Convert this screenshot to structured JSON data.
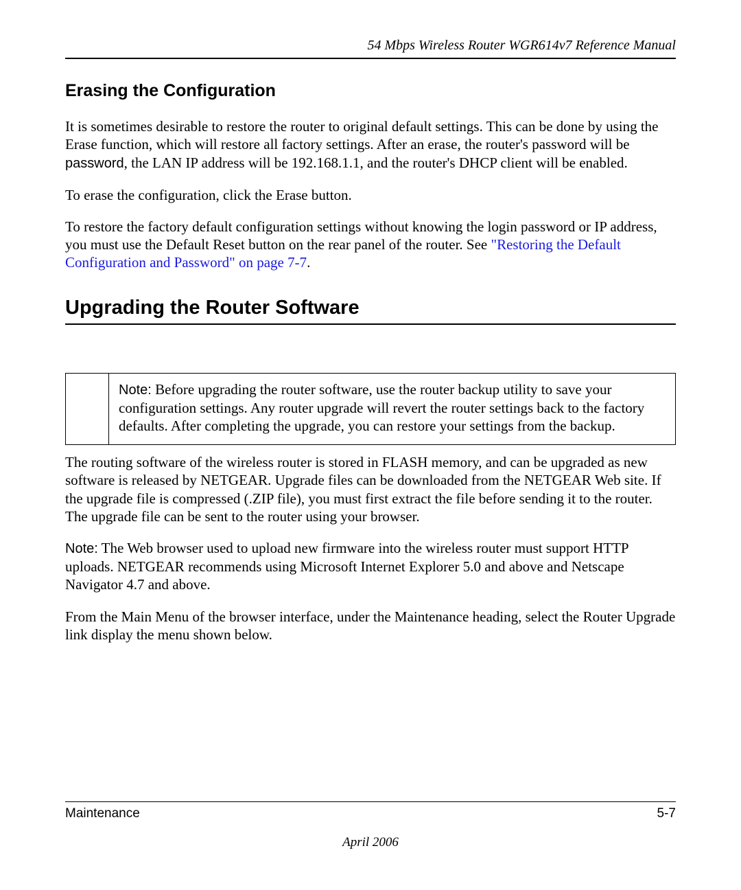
{
  "header": {
    "running_title": "54 Mbps Wireless Router WGR614v7 Reference Manual"
  },
  "section1": {
    "heading": "Erasing the Configuration",
    "p1_a": "It is sometimes desirable to restore the router to original default settings. This can be done by using the Erase function, which will restore all factory settings. After an erase, the router's password will be ",
    "p1_code": "password",
    "p1_b": ", the LAN IP address will be 192.168.1.1, and the router's DHCP client will be enabled.",
    "p2": "To erase the configuration, click the Erase button.",
    "p3_a": "To restore the factory default configuration settings without knowing the login password or IP address, you must use the Default Reset button on the rear panel of the router. See ",
    "p3_link": "\"Restoring the Default Configuration and Password\" on page 7-7",
    "p3_b": "."
  },
  "section2": {
    "heading": "Upgrading the Router Software",
    "note_label": "Note:",
    "note_text": " Before upgrading the router software, use the router backup utility to save your configuration settings. Any router upgrade will revert the router settings back to the factory defaults. After completing the upgrade, you can restore your settings from the backup.",
    "p1": "The routing software of the wireless router is stored in FLASH memory, and can be upgraded as new software is released by NETGEAR. Upgrade files can be downloaded from the NETGEAR Web site. If the upgrade file is compressed (.ZIP file), you must first extract the file before sending it to the router. The upgrade file can be sent to the router using your browser.",
    "p2_label": "Note:",
    "p2_text": " The Web browser used to upload new firmware into the wireless router must support HTTP uploads. NETGEAR recommends using Microsoft Internet Explorer 5.0 and above and Netscape Navigator 4.7 and above.",
    "p3": "From the Main Menu of the browser interface, under the Maintenance heading, select the Router Upgrade link display the menu shown below."
  },
  "footer": {
    "section_name": "Maintenance",
    "page_number": "5-7",
    "date": "April 2006"
  }
}
